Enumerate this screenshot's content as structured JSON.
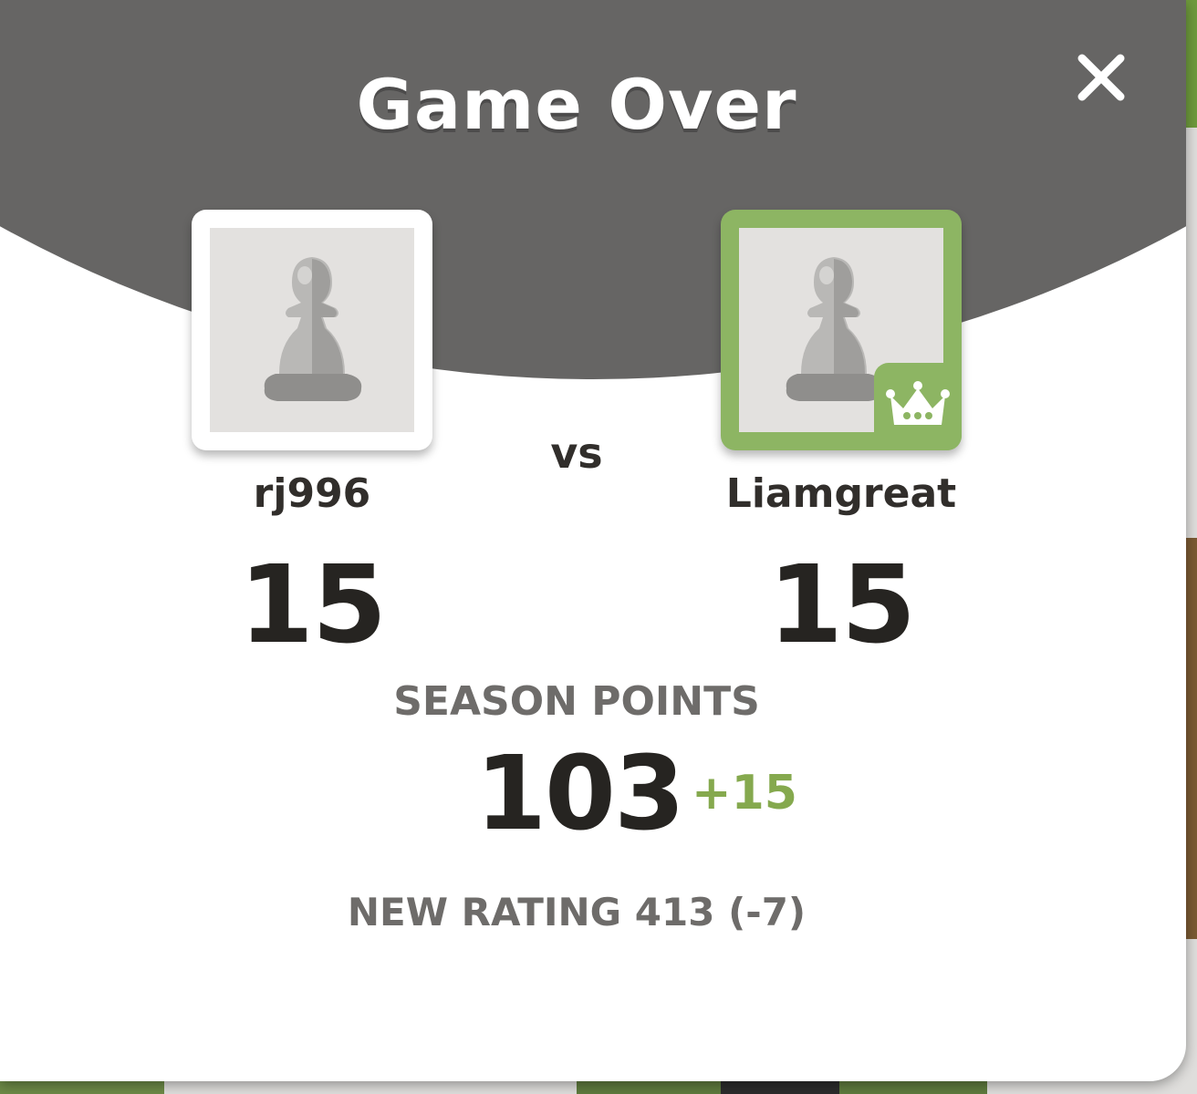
{
  "dialog": {
    "title": "Game Over",
    "close_icon": "close-icon"
  },
  "players": {
    "left": {
      "username": "rj996",
      "score": "15",
      "avatar_icon": "pawn-icon",
      "winner": false
    },
    "right": {
      "username": "Liamgreat",
      "score": "15",
      "avatar_icon": "pawn-icon",
      "winner": true,
      "badge_icon": "crown-icon"
    },
    "separator": "vs"
  },
  "season": {
    "label": "SEASON POINTS",
    "value": "103",
    "delta": "+15"
  },
  "rating": {
    "text": "NEW RATING 413 (-7)"
  },
  "colors": {
    "header": "#666564",
    "winner_accent": "#8db563",
    "positive_delta": "#85a94e"
  }
}
